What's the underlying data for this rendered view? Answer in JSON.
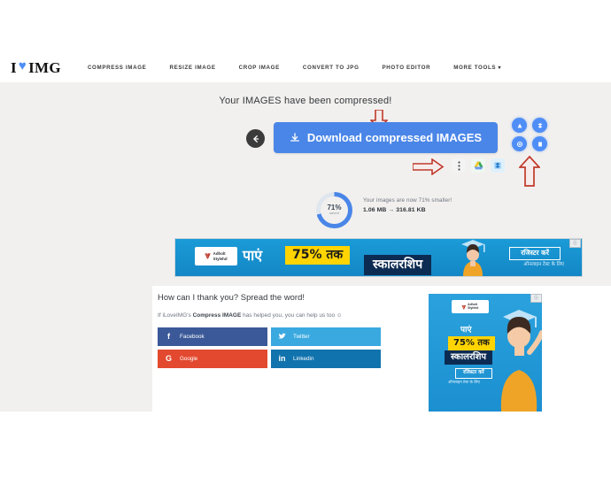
{
  "header": {
    "logo": {
      "pre": "I",
      "heart": "♥",
      "post": "IMG"
    },
    "nav": [
      {
        "label": "COMPRESS IMAGE",
        "name": "nav-compress-image"
      },
      {
        "label": "RESIZE IMAGE",
        "name": "nav-resize-image"
      },
      {
        "label": "CROP IMAGE",
        "name": "nav-crop-image"
      },
      {
        "label": "CONVERT TO JPG",
        "name": "nav-convert-to-jpg"
      },
      {
        "label": "PHOTO EDITOR",
        "name": "nav-photo-editor"
      },
      {
        "label": "MORE TOOLS ▾",
        "name": "nav-more-tools"
      }
    ]
  },
  "main": {
    "headline": "Your IMAGES have been compressed!",
    "download_button": {
      "label": "Download compressed IMAGES",
      "icon": "download-icon"
    },
    "back_button": {
      "icon": "arrow-left-icon"
    },
    "cloud_buttons": [
      {
        "name": "google-drive-upload-icon",
        "glyph": "▲"
      },
      {
        "name": "dropbox-upload-icon",
        "glyph": "✦"
      },
      {
        "name": "share-link-icon",
        "glyph": "⬇"
      },
      {
        "name": "delete-file-icon",
        "glyph": "▢"
      }
    ],
    "action_icons": [
      {
        "name": "more-options-icon",
        "glyph": "⋮"
      },
      {
        "name": "google-drive-icon",
        "glyph": "▲"
      },
      {
        "name": "dropbox-icon",
        "glyph": "▣"
      }
    ],
    "annotations": {
      "arrow_down": "red-down-arrow",
      "arrow_right": "red-right-arrow",
      "arrow_up": "red-up-arrow"
    },
    "stats": {
      "percent": "71%",
      "percent_value": 71,
      "saved_label": "saved",
      "line1": "Your images are now 71% smaller!",
      "line2": "1.06 MB → 316.81 KB",
      "original_size": "1.06 MB",
      "compressed_size": "316.81 KB"
    }
  },
  "banner_ad": {
    "ad_badge": "ⓘ",
    "brand": "Adholt Stylehd",
    "brand_line1": "Adholt",
    "brand_line2": "Stylehd",
    "text1": "पाएं",
    "text2": "75% तक",
    "text3": "स्कालरशिप",
    "cta": "रजिस्टर करें",
    "subtext": "ऑनलाइन टेस्ट के लिए"
  },
  "square_ad": {
    "ad_badge": "ⓘ",
    "brand_line1": "Adholt",
    "brand_line2": "Stylehd",
    "text1": "पाएं",
    "text2": "75% तक",
    "text3": "स्कालरशिप",
    "cta": "रजिस्टर करें",
    "subtext": "ऑनलाइन टेस्ट के लिए"
  },
  "thanks": {
    "title": "How can I thank you? Spread the word!",
    "sub_pre": "If iLoveIMG's ",
    "sub_bold": "Compress IMAGE",
    "sub_post": " has helped you, you can help us too ☺",
    "social": [
      {
        "label": "Facebook",
        "icon": "f",
        "name": "share-facebook-button"
      },
      {
        "label": "Twitter",
        "icon": "🐦",
        "name": "share-twitter-button"
      },
      {
        "label": "Google",
        "icon": "G",
        "name": "share-google-button"
      },
      {
        "label": "Linkedin",
        "icon": "in",
        "name": "share-linkedin-button"
      }
    ]
  },
  "colors": {
    "primary": "#4a86e8",
    "accent_blue": "#4f8ef7",
    "annotation_red": "#c0392b",
    "band": "#f2f0ee"
  }
}
